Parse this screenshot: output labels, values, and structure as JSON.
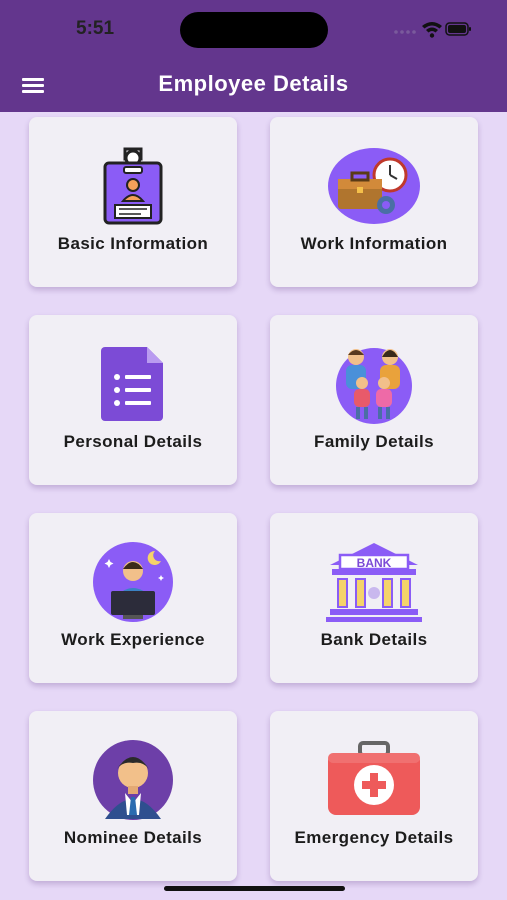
{
  "status_bar": {
    "time": "5:51"
  },
  "header": {
    "title": "Employee Details",
    "menu_icon": "hamburger-menu-icon"
  },
  "cards": [
    {
      "label": "Basic Information",
      "icon": "id-badge-icon"
    },
    {
      "label": "Work Information",
      "icon": "briefcase-clock-icon"
    },
    {
      "label": "Personal Details",
      "icon": "form-document-icon"
    },
    {
      "label": "Family Details",
      "icon": "family-icon"
    },
    {
      "label": "Work Experience",
      "icon": "worker-at-desk-icon"
    },
    {
      "label": "Bank Details",
      "icon": "bank-icon"
    },
    {
      "label": "Nominee Details",
      "icon": "businessman-avatar-icon"
    },
    {
      "label": "Emergency Details",
      "icon": "first-aid-kit-icon"
    }
  ],
  "colors": {
    "header": "#63368d",
    "background": "#e6d8f7",
    "card": "#f1eff5"
  }
}
